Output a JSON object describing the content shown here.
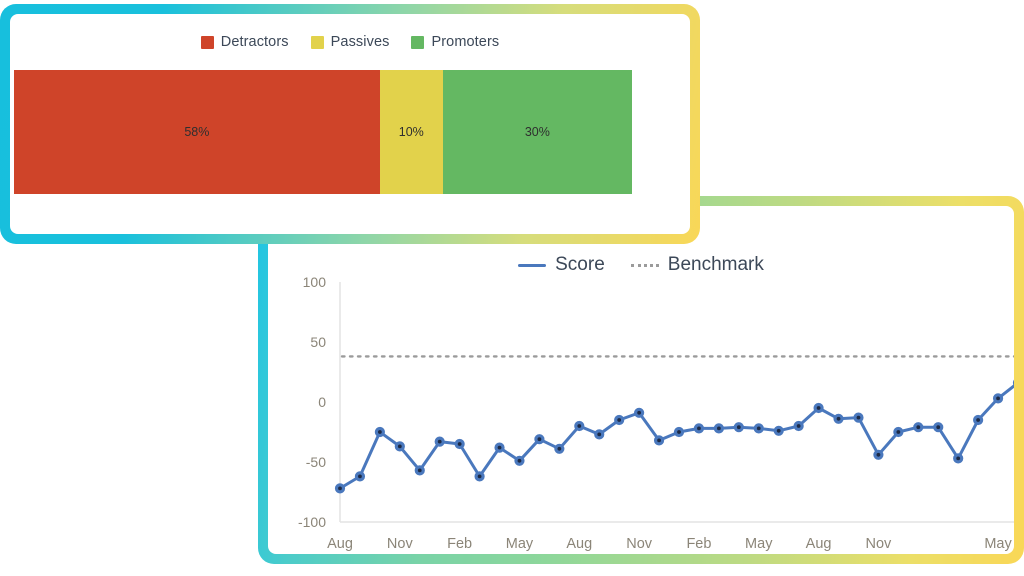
{
  "nps_card": {
    "legend": [
      {
        "label": "Detractors",
        "color": "#cf4429"
      },
      {
        "label": "Passives",
        "color": "#e2d24b"
      },
      {
        "label": "Promoters",
        "color": "#64b862"
      }
    ],
    "chart_data": {
      "type": "bar",
      "subtype": "stacked-horizontal-100",
      "title": "",
      "categories": [
        "Detractors",
        "Passives",
        "Promoters"
      ],
      "values": [
        58,
        10,
        30
      ],
      "value_labels": [
        "58%",
        "10%",
        "30%"
      ],
      "colors": [
        "#cf4429",
        "#e2d24b",
        "#64b862"
      ],
      "legend_position": "top-center",
      "grid": false,
      "xlabel": "",
      "ylabel": "",
      "xlim": [
        0,
        98
      ]
    }
  },
  "trend_card": {
    "legend": [
      {
        "label": "Score",
        "style": "solid",
        "color": "#4a78bd"
      },
      {
        "label": "Benchmark",
        "style": "dotted",
        "color": "#9b9b9b"
      }
    ],
    "chart_data": {
      "type": "line",
      "title": "",
      "xlabel": "",
      "ylabel": "",
      "ylim": [
        -100,
        100
      ],
      "yticks": [
        100,
        50,
        0,
        -50,
        -100
      ],
      "ytick_labels": [
        "100",
        "50",
        "0",
        "-50",
        "-100"
      ],
      "grid": false,
      "legend_position": "top-center",
      "xtick_labels": [
        "Aug",
        "Nov",
        "Feb",
        "May",
        "Aug",
        "Nov",
        "Feb",
        "May",
        "Aug",
        "Nov",
        "",
        "May"
      ],
      "xtick_indices": [
        0,
        3,
        6,
        9,
        12,
        15,
        18,
        21,
        24,
        27,
        30,
        33
      ],
      "series": [
        {
          "name": "Score",
          "color": "#4a78bd",
          "style": "solid",
          "markers": true,
          "values": [
            -72,
            -62,
            -25,
            -37,
            -57,
            -33,
            -35,
            -62,
            -38,
            -49,
            -31,
            -39,
            -20,
            -27,
            -15,
            -9,
            -32,
            -25,
            -22,
            -22,
            -21,
            -22,
            -24,
            -20,
            -5,
            -14,
            -13,
            -44,
            -25,
            -21,
            -21,
            -47,
            -15,
            3,
            16
          ]
        },
        {
          "name": "Benchmark",
          "color": "#9b9b9b",
          "style": "dotted",
          "markers": false,
          "constant": 38
        }
      ]
    }
  }
}
